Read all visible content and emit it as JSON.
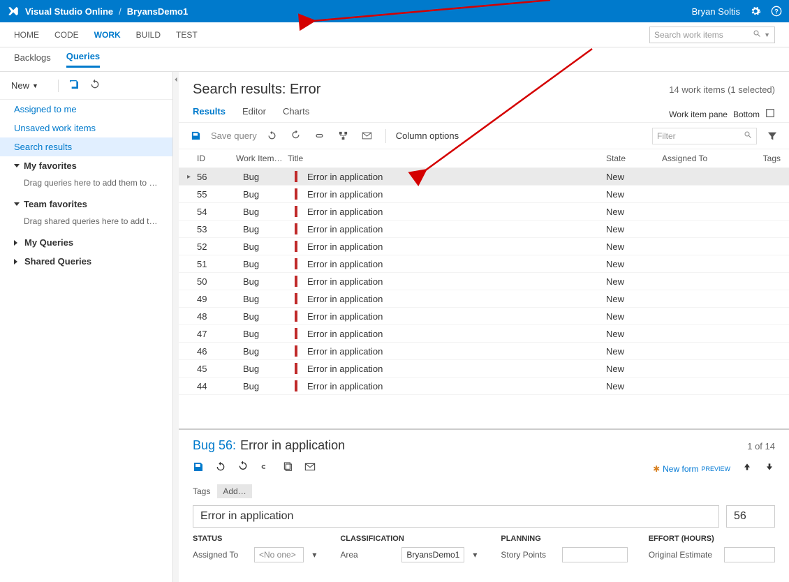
{
  "topbar": {
    "brand": "Visual Studio Online",
    "project": "BryansDemo1",
    "user": "Bryan Soltis"
  },
  "hubs": {
    "items": [
      "HOME",
      "CODE",
      "WORK",
      "BUILD",
      "TEST"
    ],
    "active": "WORK",
    "search_placeholder": "Search work items"
  },
  "subhubs": {
    "items": [
      "Backlogs",
      "Queries"
    ],
    "active": "Queries"
  },
  "sidebar": {
    "new_label": "New",
    "links": {
      "assigned": "Assigned to me",
      "unsaved": "Unsaved work items",
      "search": "Search results"
    },
    "sections": {
      "myfav": "My favorites",
      "myfav_hint": "Drag queries here to add them to y…",
      "teamfav": "Team favorites",
      "teamfav_hint": "Drag shared queries here to add th…",
      "myq": "My Queries",
      "sharedq": "Shared Queries"
    }
  },
  "main": {
    "title": "Search results: Error",
    "summary": "14 work items (1 selected)",
    "tabs": [
      "Results",
      "Editor",
      "Charts"
    ],
    "active_tab": "Results",
    "pane_label": "Work item pane",
    "pane_value": "Bottom",
    "toolbar": {
      "save": "Save query",
      "column_options": "Column options",
      "filter_placeholder": "Filter"
    },
    "columns": {
      "id": "ID",
      "type": "Work Item…",
      "title": "Title",
      "state": "State",
      "assigned": "Assigned To",
      "tags": "Tags"
    },
    "rows": [
      {
        "id": "56",
        "type": "Bug",
        "title": "Error in application",
        "state": "New"
      },
      {
        "id": "55",
        "type": "Bug",
        "title": "Error in application",
        "state": "New"
      },
      {
        "id": "54",
        "type": "Bug",
        "title": "Error in application",
        "state": "New"
      },
      {
        "id": "53",
        "type": "Bug",
        "title": "Error in application",
        "state": "New"
      },
      {
        "id": "52",
        "type": "Bug",
        "title": "Error in application",
        "state": "New"
      },
      {
        "id": "51",
        "type": "Bug",
        "title": "Error in application",
        "state": "New"
      },
      {
        "id": "50",
        "type": "Bug",
        "title": "Error in application",
        "state": "New"
      },
      {
        "id": "49",
        "type": "Bug",
        "title": "Error in application",
        "state": "New"
      },
      {
        "id": "48",
        "type": "Bug",
        "title": "Error in application",
        "state": "New"
      },
      {
        "id": "47",
        "type": "Bug",
        "title": "Error in application",
        "state": "New"
      },
      {
        "id": "46",
        "type": "Bug",
        "title": "Error in application",
        "state": "New"
      },
      {
        "id": "45",
        "type": "Bug",
        "title": "Error in application",
        "state": "New"
      },
      {
        "id": "44",
        "type": "Bug",
        "title": "Error in application",
        "state": "New"
      }
    ]
  },
  "detail": {
    "prefix": "Bug 56:",
    "title": "Error in application",
    "count": "1 of 14",
    "newform": "New form",
    "newform_sup": "PREVIEW",
    "tags_label": "Tags",
    "add_tag": "Add…",
    "title_value": "Error in application",
    "id_value": "56",
    "sections": {
      "status": "STATUS",
      "classification": "CLASSIFICATION",
      "planning": "PLANNING",
      "effort": "EFFORT (HOURS)"
    },
    "fields": {
      "assigned_label": "Assigned To",
      "assigned_value": "<No one>",
      "area_label": "Area",
      "area_value": "BryansDemo1",
      "story_label": "Story Points",
      "orig_label": "Original Estimate"
    }
  }
}
